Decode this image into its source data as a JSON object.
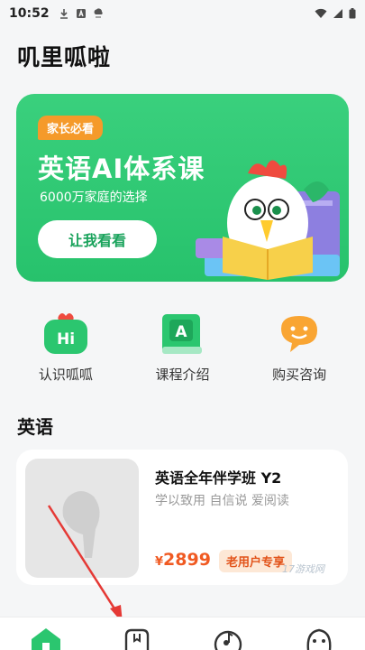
{
  "status_bar": {
    "time": "10:52"
  },
  "app": {
    "title": "叽里呱啦"
  },
  "banner": {
    "tag": "家长必看",
    "title": "英语AI体系课",
    "subtitle": "6000万家庭的选择",
    "cta": "让我看看"
  },
  "quick_menu": [
    {
      "label": "认识呱呱",
      "icon": "hi-chat-icon"
    },
    {
      "label": "课程介绍",
      "icon": "book-icon"
    },
    {
      "label": "购买咨询",
      "icon": "chat-smile-icon"
    }
  ],
  "section": {
    "title": "英语"
  },
  "course": {
    "name": "英语全年伴学班 Y2",
    "tagline": "学以致用 自信说 爱阅读",
    "currency": "¥",
    "price": "2899",
    "badge": "老用户专享"
  },
  "watermark": "17游戏网",
  "tab_bar": [
    "home-tab-icon",
    "course-tab-icon",
    "music-tab-icon",
    "profile-tab-icon"
  ],
  "colors": {
    "brand_green": "#2bc66f",
    "price_orange": "#f05a22",
    "tag_orange": "#f59a2a"
  }
}
